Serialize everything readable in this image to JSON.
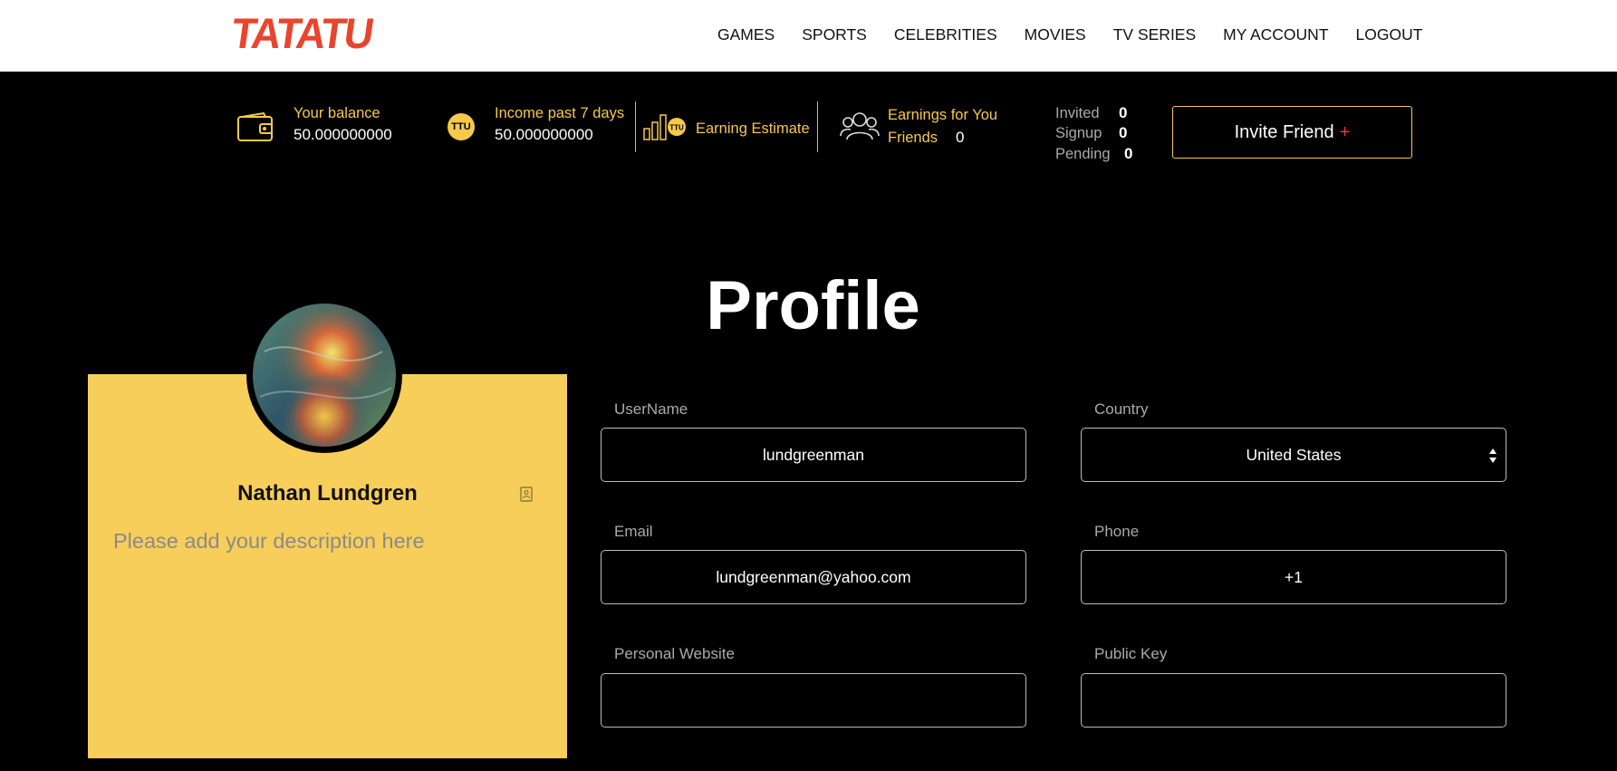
{
  "brand": {
    "logo_text": "TATATU",
    "logo_color": "#e8452c"
  },
  "nav": {
    "items": [
      "GAMES",
      "SPORTS",
      "CELEBRITIES",
      "MOVIES",
      "TV SERIES",
      "MY ACCOUNT",
      "LOGOUT"
    ]
  },
  "stats": {
    "balance_label": "Your balance",
    "balance_value": "50.000000000",
    "income_label": "Income past 7 days",
    "income_value": "50.000000000",
    "coin_text": "TTU",
    "estimate_label": "Earning Estimate",
    "earnings_label_1": "Earnings for You",
    "earnings_label_2": "Friends",
    "earnings_value": "0",
    "invited_label": "Invited",
    "invited_value": "0",
    "signup_label": "Signup",
    "signup_value": "0",
    "pending_label": "Pending",
    "pending_value": "0",
    "invite_label": "Invite Friend",
    "invite_plus": "+"
  },
  "profile": {
    "title": "Profile",
    "name": "Nathan Lundgren",
    "description_placeholder": "Please add your description here",
    "fields": {
      "username_label": "UserName",
      "username_value": "lundgreenman",
      "country_label": "Country",
      "country_value": "United States",
      "email_label": "Email",
      "email_value": "lundgreenman@yahoo.com",
      "phone_label": "Phone",
      "phone_value": "+1",
      "website_label": "Personal Website",
      "website_value": "",
      "publickey_label": "Public Key",
      "publickey_value": ""
    }
  },
  "colors": {
    "accent": "#f7c84a",
    "card": "#f7ce5a",
    "background": "#000000"
  }
}
